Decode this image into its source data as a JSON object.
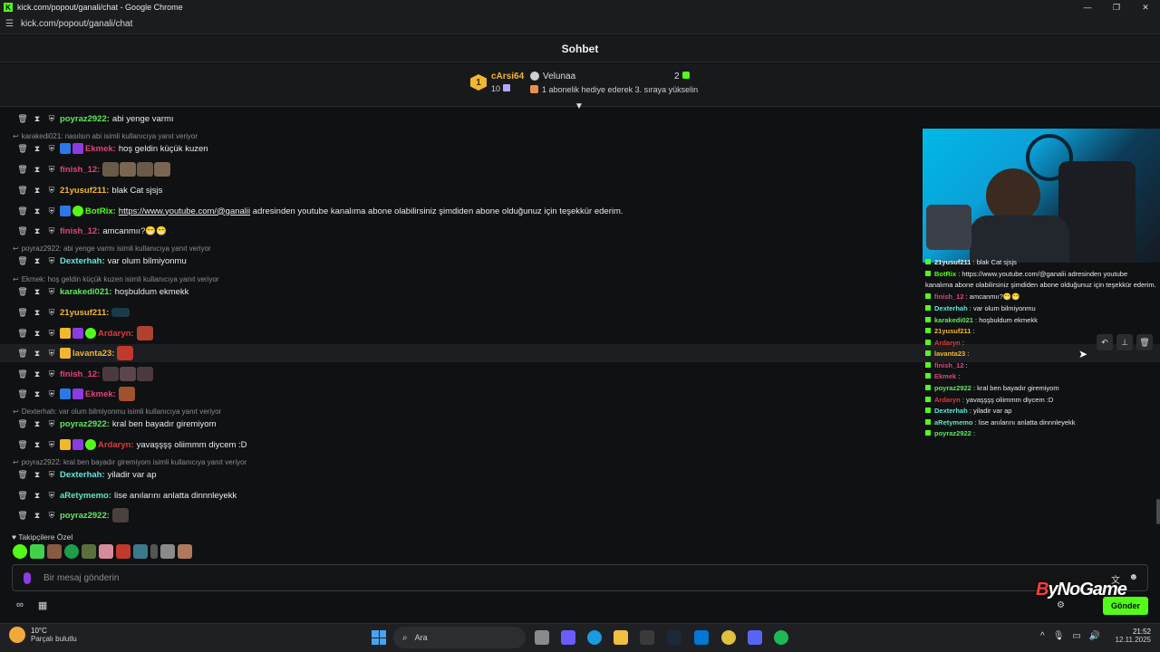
{
  "window": {
    "title": "kick.com/popout/ganali/chat - Google Chrome",
    "url": "kick.com/popout/ganali/chat"
  },
  "chat": {
    "title": "Sohbet"
  },
  "leaderboard": {
    "rank": "1",
    "top_name": "cArsi64",
    "top_count": "10",
    "second_name": "Velunaa",
    "second_count": "2",
    "announcement": "1 abonelik hediye ederek 3. sıraya yükselin"
  },
  "messages": [
    {
      "user": "poyraz2922",
      "color": "#5ee85e",
      "text": "abi yenge varmı"
    },
    {
      "reply": "karakedi021: nasılsın abi isimli kullanıcıya yanıt veriyor"
    },
    {
      "user": "Ekmek",
      "color": "#e0457b",
      "text": "hoş geldin küçük kuzen"
    },
    {
      "user": "finish_12",
      "color": "#e0457b",
      "text": ""
    },
    {
      "user": "21yusuf211",
      "color": "#f2b730",
      "text": "blak Cat sjsjs"
    },
    {
      "user": "BotRix",
      "color": "#53fc18",
      "text": "adresinden youtube kanalıma abone olabilirsiniz şimdiden abone olduğunuz için teşekkür ederim.",
      "link": "https://www.youtube.com/@ganalii"
    },
    {
      "user": "finish_12",
      "color": "#e0457b",
      "text": "amcanmıı?😁😁"
    },
    {
      "reply": "poyraz2922: abi yenge varmı isimli kullanıcıya yanıt veriyor"
    },
    {
      "user": "Dexterhah",
      "color": "#5ee8e0",
      "text": "var olum bilmiyonmu"
    },
    {
      "reply": "Ekmek: hoş geldin küçük kuzen isimli kullanıcıya yanıt veriyor"
    },
    {
      "user": "karakedi021",
      "color": "#5ee85e",
      "text": "hoşbuldum ekmekk"
    },
    {
      "user": "21yusuf211",
      "color": "#f2b730",
      "text": ""
    },
    {
      "user": "Ardaryn",
      "color": "#e03b3b",
      "text": ""
    },
    {
      "user": "lavanta23",
      "color": "#f2b730",
      "text": ""
    },
    {
      "user": "finish_12",
      "color": "#e0457b",
      "text": ""
    },
    {
      "user": "Ekmek",
      "color": "#e0457b",
      "text": ""
    },
    {
      "reply": "Dexterhah: var olum bilmiyonmu isimli kullanıcıya yanıt veriyor"
    },
    {
      "user": "poyraz2922",
      "color": "#5ee85e",
      "text": "kral ben bayadır giremiyom"
    },
    {
      "user": "Ardaryn",
      "color": "#e03b3b",
      "text": "yavaşşşş oliimmm diycem :D"
    },
    {
      "reply": "poyraz2922: kral ben bayadır giremiyom isimli kullanıcıya yanıt veriyor"
    },
    {
      "user": "Dexterhah",
      "color": "#5ee8e0",
      "text": "yiladir var ap"
    },
    {
      "user": "aRetymemo",
      "color": "#5ee8c0",
      "text": "lise anılarını anlatta dinnnleyekk"
    },
    {
      "user": "poyraz2922",
      "color": "#5ee85e",
      "text": ""
    }
  ],
  "followers_label": "Takipçilere Özel",
  "input": {
    "placeholder": "Bir mesaj gönderin",
    "send_label": "Gönder"
  },
  "watermark": {
    "prefix": "B",
    "rest": "yNoGame"
  },
  "overlay_chat": [
    {
      "user": "21yusuf211",
      "text": ": blak Cat sjsjs"
    },
    {
      "user": "BotRix",
      "text": ": https://www.youtube.com/@ganalii adresinden youtube"
    },
    {
      "user": "",
      "text": "kanalıma abone olabilirsiniz şimdiden abone olduğunuz için teşekkür ederim."
    },
    {
      "user": "finish_12",
      "text": ": amcanmıı?😁😁"
    },
    {
      "user": "Dexterhah",
      "text": ": var olum bilmiyonmu"
    },
    {
      "user": "karakedi021",
      "text": ": hoşbuldum ekmekk"
    },
    {
      "user": "21yusuf211",
      "text": ":"
    },
    {
      "user": "Ardaryn",
      "text": ":"
    },
    {
      "user": "lavanta23",
      "text": ":"
    },
    {
      "user": "finish_12",
      "text": ":"
    },
    {
      "user": "Ekmek",
      "text": ":"
    },
    {
      "user": "poyraz2922",
      "text": ": kral ben bayadır giremiyom"
    },
    {
      "user": "Ardaryn",
      "text": ": yavaşşşş oliimmm diycem :D"
    },
    {
      "user": "Dexterhah",
      "text": ": yiladir var ap"
    },
    {
      "user": "aRetymemo",
      "text": ": lise anılarını anlatta dinnnleyekk"
    },
    {
      "user": "poyraz2922",
      "text": ":"
    }
  ],
  "taskbar": {
    "temperature": "10°C",
    "weather": "Parçalı bulutlu",
    "search": "Ara",
    "time": "21:52",
    "date": "12.11.2025"
  }
}
